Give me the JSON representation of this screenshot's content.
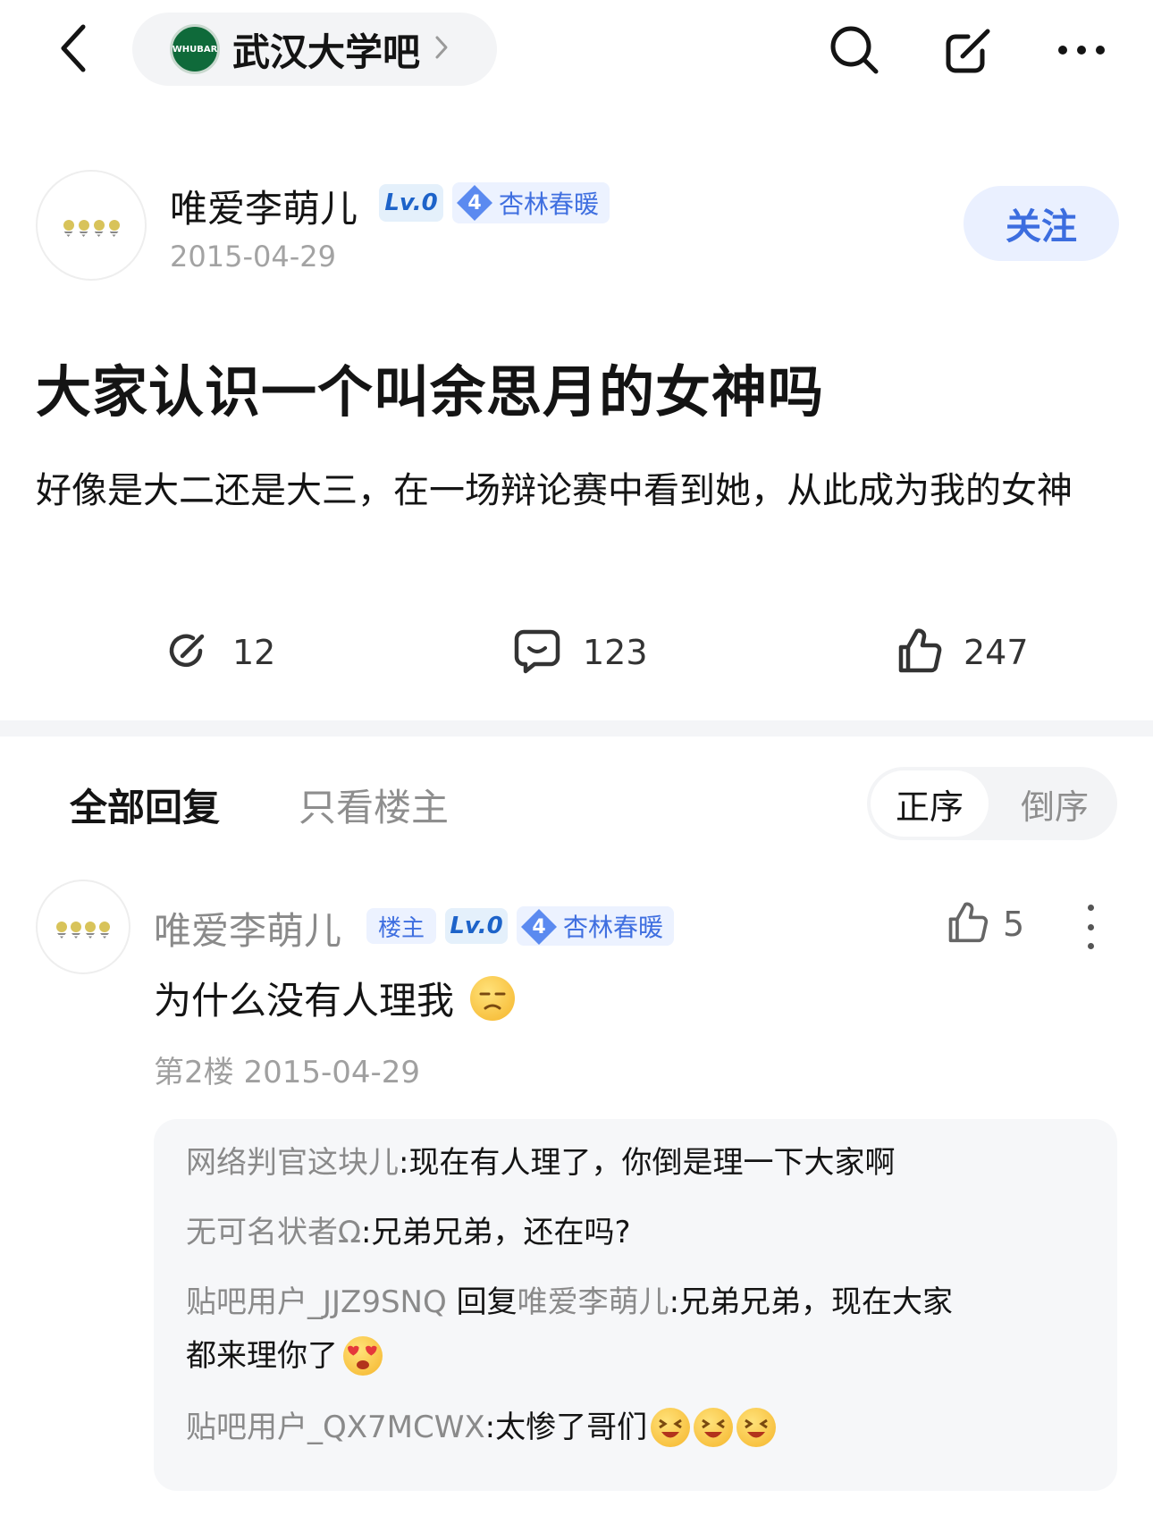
{
  "nav": {
    "forum_name": "武汉大学吧",
    "forum_logo_text": "WHUBAR",
    "icons": [
      "back-arrow-icon",
      "search-icon",
      "compose-icon",
      "more-icon"
    ]
  },
  "post": {
    "author": {
      "name": "唯爱李萌儿",
      "level": "Lv.0",
      "title_level": "4",
      "title": "杏林春暖"
    },
    "date": "2015-04-29",
    "follow_label": "关注",
    "title": "大家认识一个叫余思月的女神吗",
    "body": "好像是大二还是大三，在一场辩论赛中看到她，从此成为我的女神",
    "stats": {
      "shares": "12",
      "comments": "123",
      "likes": "247"
    }
  },
  "replies_header": {
    "tab_all": "全部回复",
    "tab_op_only": "只看楼主",
    "sort_asc": "正序",
    "sort_desc": "倒序"
  },
  "comment": {
    "author": "唯爱李萌儿",
    "op_badge": "楼主",
    "level": "Lv.0",
    "title_level": "4",
    "title": "杏林春暖",
    "likes": "5",
    "text": "为什么没有人理我",
    "floor": "第2楼",
    "date": "2015-04-29",
    "sub_replies": [
      {
        "user": "网络判官这块儿",
        "sep": ":",
        "text": "现在有人理了，你倒是理一下大家啊"
      },
      {
        "user": "无可名状者Ω",
        "sep": ":",
        "text": "兄弟兄弟，还在吗?"
      },
      {
        "user": "贴吧用户_JJZ9SNQ",
        "reply_word": "回复",
        "reply_to": "唯爱李萌儿",
        "sep": ":",
        "text": "兄弟兄弟，现在大家",
        "text_cont": "都来理你了"
      },
      {
        "user": "贴吧用户_QX7MCWX",
        "sep": ":",
        "text": "太惨了哥们"
      }
    ]
  },
  "colors": {
    "accent_blue": "#3c6ddf",
    "badge_bg": "#ecf2ff",
    "muted_text": "#8a8a8a",
    "divider": "#f4f5f7"
  }
}
